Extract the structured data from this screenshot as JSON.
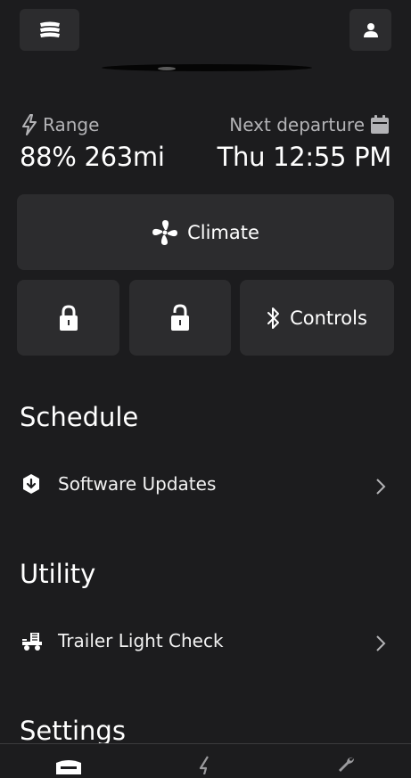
{
  "header": {
    "menu_icon": "vehicle-menu-icon",
    "profile_icon": "person-icon"
  },
  "stats": {
    "range_label": "Range",
    "range_value": "88% 263mi",
    "departure_label": "Next departure",
    "departure_value": "Thu 12:55 PM"
  },
  "actions": {
    "climate_label": "Climate",
    "lock_icon": "lock-icon",
    "unlock_icon": "unlock-icon",
    "controls_label": "Controls"
  },
  "sections": {
    "schedule_title": "Schedule",
    "software_updates_label": "Software Updates",
    "utility_title": "Utility",
    "trailer_label": "Trailer Light Check",
    "settings_title": "Settings"
  },
  "bottom_nav": {
    "items": [
      "vehicle-tab-icon",
      "charging-tab-icon",
      "service-tab-icon"
    ]
  },
  "colors": {
    "background": "#1c1c1e",
    "tile": "#2c2c2e",
    "secondary_text": "#b3b3b6"
  }
}
